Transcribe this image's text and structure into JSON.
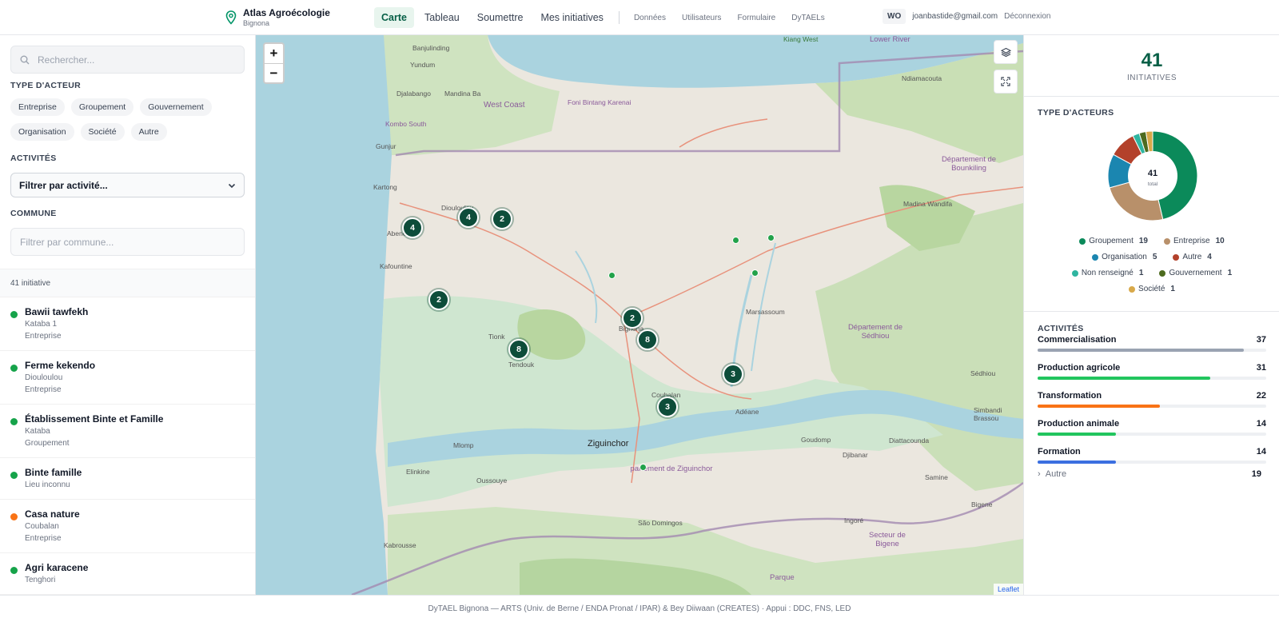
{
  "header": {
    "brand_title": "Atlas Agroécologie",
    "brand_sub": "Bignona",
    "tabs": [
      {
        "label": "Carte",
        "active": true
      },
      {
        "label": "Tableau"
      },
      {
        "label": "Soumettre"
      },
      {
        "label": "Mes initiatives"
      }
    ],
    "admin_links": [
      "Données",
      "Utilisateurs",
      "Formulaire",
      "DyTAELs"
    ],
    "avatar": "WO",
    "email": "joanbastide@gmail.com",
    "logout": "Déconnexion"
  },
  "sidebar": {
    "search_placeholder": "Rechercher...",
    "actor_type_label": "TYPE D'ACTEUR",
    "actor_types": [
      "Entreprise",
      "Groupement",
      "Gouvernement",
      "Organisation",
      "Société",
      "Autre"
    ],
    "activities_label": "ACTIVITÉS",
    "activities_select": "Filtrer par activité...",
    "commune_label": "COMMUNE",
    "commune_placeholder": "Filtrer par commune...",
    "count_text": "41 initiative",
    "items": [
      {
        "title": "Bawii tawfekh",
        "place": "Kataba 1",
        "type": "Entreprise",
        "color": "#16a34a"
      },
      {
        "title": "Ferme kekendo",
        "place": "Diouloulou",
        "type": "Entreprise",
        "color": "#16a34a"
      },
      {
        "title": "Établissement Binte et Famille",
        "place": "Kataba",
        "type": "Groupement",
        "color": "#16a34a"
      },
      {
        "title": "Binte famille",
        "place": "Lieu inconnu",
        "type": "",
        "color": "#16a34a"
      },
      {
        "title": "Casa nature",
        "place": "Coubalan",
        "type": "Entreprise",
        "color": "#f97316"
      },
      {
        "title": "Agri karacene",
        "place": "Tenghori",
        "type": "",
        "color": "#16a34a"
      }
    ]
  },
  "map": {
    "zoom_in": "+",
    "zoom_out": "−",
    "layers_icon": "layers-icon",
    "fullscreen_icon": "fullscreen-icon",
    "clusters": [
      "4",
      "4",
      "2",
      "2",
      "2",
      "8",
      "8",
      "3",
      "3"
    ],
    "places": {
      "bajunlinding": "Banjulinding",
      "yundum": "Yundum",
      "djalabango": "Djalabango",
      "mandina": "Mandina Ba",
      "westcoast": "West Coast",
      "foni": "Foni Bintang Karenai",
      "kombo": "Kombo South",
      "gunjur": "Gunjur",
      "kartong": "Kartong",
      "diouloulou": "Diouloulou",
      "abene": "Abene",
      "kafountine": "Kafountine",
      "tionk": "Tionk",
      "tendouk": "Tendouk",
      "bignona": "Bignona",
      "marsassoum": "Marsassoum",
      "coubalan": "Coubalan",
      "adeane": "Adéane",
      "ziguinchor": "Ziguinchor",
      "mlomp": "Mlomp",
      "elinkine": "Elinkine",
      "oussouye": "Oussouye",
      "kabrousse": "Kabrousse",
      "saodomingos": "São Domingos",
      "goudomp": "Goudomp",
      "djibanar": "Djibanar",
      "diattacounda": "Diattacounda",
      "samine": "Samine",
      "simbandi": "Simbandi Brassou",
      "sedhiou": "Sédhiou",
      "bigene": "Bigene",
      "ingore": "Ingoré",
      "madina": "Madina Wandifa",
      "ndiamacouta": "Ndiamacouta",
      "kiang": "Kiang West",
      "lowerriver": "Lower River",
      "dept_sedhiou": "Département de Sédhiou",
      "dept_bounkiling": "Département de Bounkiling",
      "dept_ziguinchor": "partement de Ziguinchor",
      "secteur": "Secteur de Bigene",
      "parque": "Parque"
    },
    "attribution": "Leaflet"
  },
  "panel": {
    "total": "41",
    "total_label": "INITIATIVES",
    "actors_label": "TYPE D'ACTEURS",
    "donut_center": "41",
    "donut_center_label": "total",
    "activities_label": "ACTIVITÉS",
    "other_label": "Autre",
    "other_count": "19"
  },
  "chart_data": [
    {
      "type": "pie",
      "title": "TYPE D'ACTEURS",
      "categories": [
        "Groupement",
        "Entreprise",
        "Organisation",
        "Autre",
        "Non renseigné",
        "Gouvernement",
        "Société"
      ],
      "values": [
        19,
        10,
        5,
        4,
        1,
        1,
        1
      ],
      "colors": [
        "#0b8a5a",
        "#b8906a",
        "#1b86b0",
        "#b3412b",
        "#2fb5a0",
        "#4d6b1f",
        "#d8a94a"
      ]
    },
    {
      "type": "bar",
      "title": "ACTIVITÉS",
      "categories": [
        "Commercialisation",
        "Production agricole",
        "Transformation",
        "Production animale",
        "Formation"
      ],
      "values": [
        37,
        31,
        22,
        14,
        14
      ],
      "max": 41,
      "colors": [
        "#9aa3b2",
        "#22c55e",
        "#f97316",
        "#22c55e",
        "#3b6fe0"
      ]
    }
  ],
  "footer": {
    "text": "DyTAEL Bignona — ARTS (Univ. de Berne / ENDA Pronat / IPAR) & Bey Diiwaan (CREATES)   ·   Appui : DDC, FNS, LED"
  }
}
